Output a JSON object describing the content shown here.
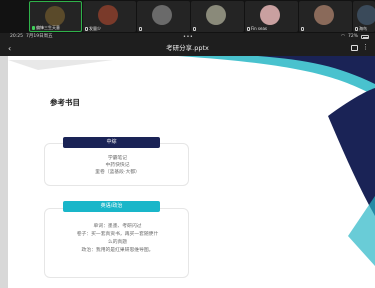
{
  "participants": [
    {
      "name": "偏锋三生天意",
      "active": true,
      "mic": "on",
      "avatar_color": "#5a4a2a"
    },
    {
      "name": "发量少",
      "active": false,
      "mic": "off",
      "avatar_color": "#7a3a2a"
    },
    {
      "name": "",
      "active": false,
      "mic": "off",
      "avatar_color": "#6a6a6a"
    },
    {
      "name": "",
      "active": false,
      "mic": "off",
      "avatar_color": "#8a8a7a"
    },
    {
      "name": "Fin seas",
      "active": false,
      "mic": "off",
      "avatar_color": "#c9a0a0"
    },
    {
      "name": "",
      "active": false,
      "mic": "off",
      "avatar_color": "#8a6a5a"
    },
    {
      "name": "海鸟",
      "active": false,
      "mic": "off",
      "avatar_color": "#3a4a5a"
    }
  ],
  "status": {
    "time": "20:25",
    "date": "7月19日周五",
    "dots": "•••",
    "battery": "72%"
  },
  "titlebar": {
    "back": "‹",
    "title": "考研分享.pptx",
    "more": "⋮"
  },
  "slide": {
    "heading": "参考书目",
    "section1": {
      "label": "中综",
      "lines": [
        "学霸笔记",
        "中药快快记",
        "里卷（蓝基段·大都）"
      ]
    },
    "section2": {
      "label": "英语/政治",
      "lines": [
        "单词：墨墨、考研闪过",
        "卷子：买一套真资书，再买一套随便什",
        "么的真题",
        "政治：我用的是红果研思维导图。"
      ]
    }
  },
  "colors": {
    "navy": "#1a2356",
    "teal": "#19b6c9",
    "active_border": "#2fb24a"
  }
}
